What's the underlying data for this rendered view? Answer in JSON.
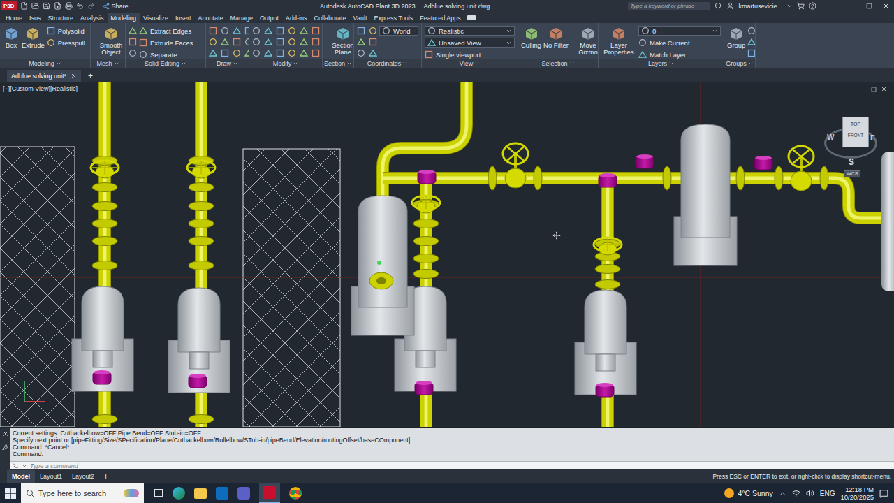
{
  "title_bar": {
    "app_badge": "P3D",
    "share": "Share",
    "title": "Autodesk AutoCAD Plant 3D 2023",
    "file": "Adblue solving unit.dwg",
    "search_placeholder": "Type a keyword or phrase",
    "user": "kmartusevicie..."
  },
  "ribbon_tabs": [
    {
      "label": "Home",
      "selected": false
    },
    {
      "label": "Isos",
      "selected": false
    },
    {
      "label": "Structure",
      "selected": false
    },
    {
      "label": "Analysis",
      "selected": false
    },
    {
      "label": "Modeling",
      "selected": true
    },
    {
      "label": "Visualize",
      "selected": false
    },
    {
      "label": "Insert",
      "selected": false
    },
    {
      "label": "Annotate",
      "selected": false
    },
    {
      "label": "Manage",
      "selected": false
    },
    {
      "label": "Output",
      "selected": false
    },
    {
      "label": "Add-ins",
      "selected": false
    },
    {
      "label": "Collaborate",
      "selected": false
    },
    {
      "label": "Vault",
      "selected": false
    },
    {
      "label": "Express Tools",
      "selected": false
    },
    {
      "label": "Featured Apps",
      "selected": false
    }
  ],
  "ribbon_panels": [
    {
      "title": "Modeling",
      "buttons": [
        {
          "label": "Box",
          "kind": "large"
        },
        {
          "label": "Extrude",
          "kind": "large"
        },
        {
          "label": "Polysolid",
          "kind": "small"
        },
        {
          "label": "Presspull",
          "kind": "small"
        }
      ]
    },
    {
      "title": "Mesh",
      "buttons": [
        {
          "label": "Smooth Object",
          "kind": "large"
        }
      ]
    },
    {
      "title": "Solid Editing",
      "buttons": [
        {
          "label": "Extract Edges",
          "kind": "small"
        },
        {
          "label": "Extrude Faces",
          "kind": "small"
        },
        {
          "label": "Separate",
          "kind": "small"
        }
      ]
    },
    {
      "title": "Draw",
      "buttons": []
    },
    {
      "title": "Modify",
      "buttons": []
    },
    {
      "title": "Section",
      "buttons": [
        {
          "label": "Section Plane",
          "kind": "large"
        }
      ]
    },
    {
      "title": "Coordinates",
      "buttons": [
        {
          "label": "World",
          "kind": "dropdown"
        }
      ]
    },
    {
      "title": "View",
      "buttons": [
        {
          "label": "Realistic",
          "kind": "dropdown"
        },
        {
          "label": "Unsaved View",
          "kind": "dropdown"
        },
        {
          "label": "Single viewport",
          "kind": "small"
        }
      ]
    },
    {
      "title": "Selection",
      "buttons": [
        {
          "label": "Culling",
          "kind": "large"
        },
        {
          "label": "No Filter",
          "kind": "large"
        },
        {
          "label": "Move Gizmo",
          "kind": "large"
        }
      ]
    },
    {
      "title": "Layers",
      "buttons": [
        {
          "label": "Layer Properties",
          "kind": "large"
        },
        {
          "label": "0",
          "kind": "dropdown"
        },
        {
          "label": "Make Current",
          "kind": "small"
        },
        {
          "label": "Match Layer",
          "kind": "small"
        }
      ]
    },
    {
      "title": "Groups",
      "buttons": [
        {
          "label": "Group",
          "kind": "large"
        }
      ]
    }
  ],
  "document_tabs": [
    {
      "label": "Adblue solving unit*",
      "selected": true
    }
  ],
  "new_document": "+",
  "viewport": {
    "label": "[−][Custom View][Realistic]",
    "viewcube": {
      "top": "TOP",
      "front": "FRONT",
      "west": "W",
      "east": "E",
      "south": "S",
      "ucs": "WCS"
    }
  },
  "command_history": [
    "Current settings: Cutbackelbow=OFF Pipe Bend=OFF Stub-in=OFF",
    "Specify next point or [pipeFitting/Size/SPecification/Plane/Cutbackelbow/Rollelbow/STub-in/pipeBend/Elevation/routingOffset/baseCOmponent]:",
    "Command: *Cancel*",
    "Command:"
  ],
  "command_placeholder": "Type a command",
  "layout_tabs": [
    {
      "label": "Model",
      "selected": true
    },
    {
      "label": "Layout1",
      "selected": false
    },
    {
      "label": "Layout2",
      "selected": false
    }
  ],
  "add_layout": "+",
  "status_hint": "Press ESC or ENTER to exit, or right-click to display shortcut-menu.",
  "taskbar": {
    "search_placeholder": "Type here to search",
    "weather": "4°C Sunny",
    "language": "ENG",
    "time": "12:18 PM",
    "date": "10/20/2025"
  }
}
